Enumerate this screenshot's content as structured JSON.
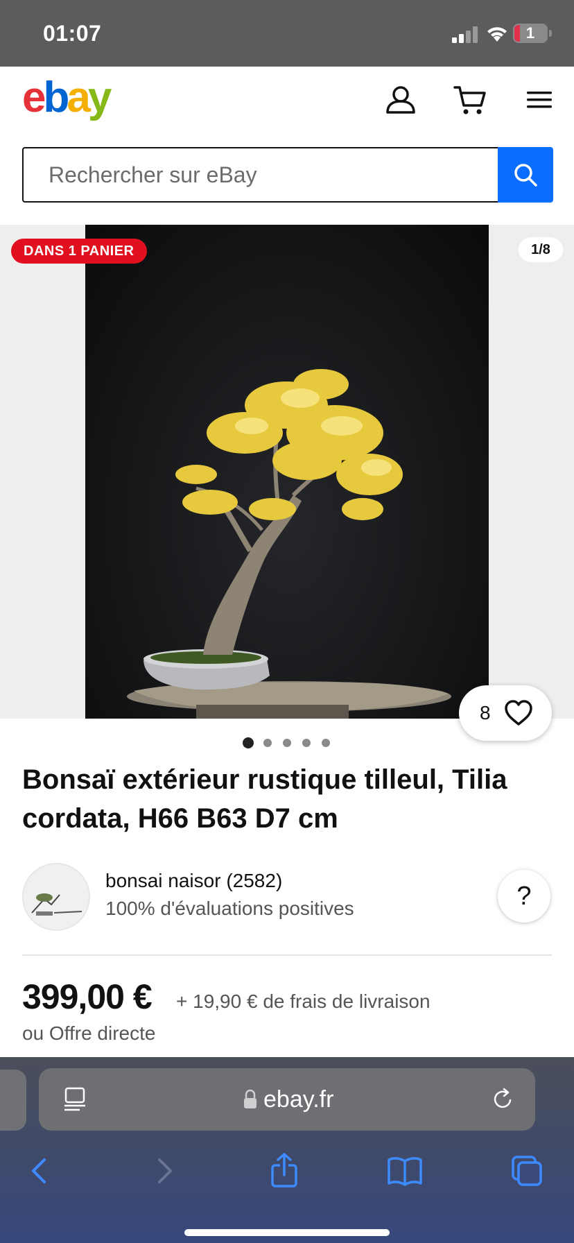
{
  "status_bar": {
    "time": "01:07",
    "battery": "1"
  },
  "header": {
    "logo": {
      "e": "e",
      "b": "b",
      "a": "a",
      "y": "y"
    },
    "icons": [
      "account-icon",
      "cart-icon",
      "menu-icon"
    ]
  },
  "search": {
    "placeholder": "Rechercher sur eBay"
  },
  "gallery": {
    "badge": "DANS 1 PANIER",
    "counter": "1/8",
    "watch_count": "8",
    "dots_total": 5,
    "dots_active": 1
  },
  "listing": {
    "title": "Bonsaï extérieur rustique tilleul, Tilia cordata, H66 B63 D7 cm",
    "seller_name": "bonsai naisor (2582)",
    "seller_rating": "100% d'évaluations positives",
    "help": "?",
    "price": "399,00 €",
    "shipping": "+ 19,90 € de frais de livraison",
    "offer": "ou Offre directe"
  },
  "browser": {
    "url": "ebay.fr"
  },
  "colors": {
    "badge_red": "#e0101f",
    "search_blue": "#0a6dff",
    "logo_red": "#e53238",
    "logo_blue": "#0064d2",
    "logo_yellow": "#f5af02",
    "logo_green": "#86b817"
  }
}
